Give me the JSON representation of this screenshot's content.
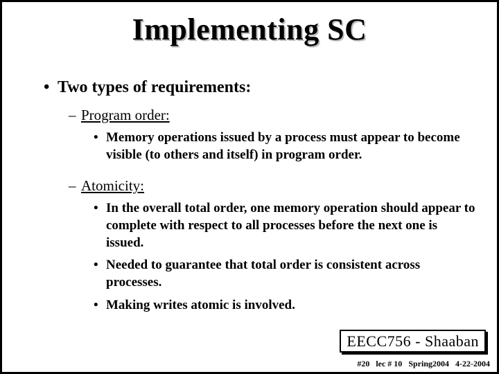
{
  "title": "Implementing SC",
  "intro": "Two types of requirements:",
  "sections": [
    {
      "label": "Program order:",
      "items": [
        "Memory operations issued by a process must appear to become visible (to others and itself) in program order."
      ]
    },
    {
      "label": "Atomicity:",
      "items": [
        "In the overall total order, one memory operation should appear to complete with respect to all processes before the next one is issued.",
        "Needed to guarantee that total order is consistent across processes.",
        "Making writes atomic is involved."
      ]
    }
  ],
  "footer": {
    "course": "EECC756 - Shaaban",
    "meta": {
      "slide": "#20",
      "lec": "lec # 10",
      "term": "Spring2004",
      "date": "4-22-2004"
    }
  }
}
